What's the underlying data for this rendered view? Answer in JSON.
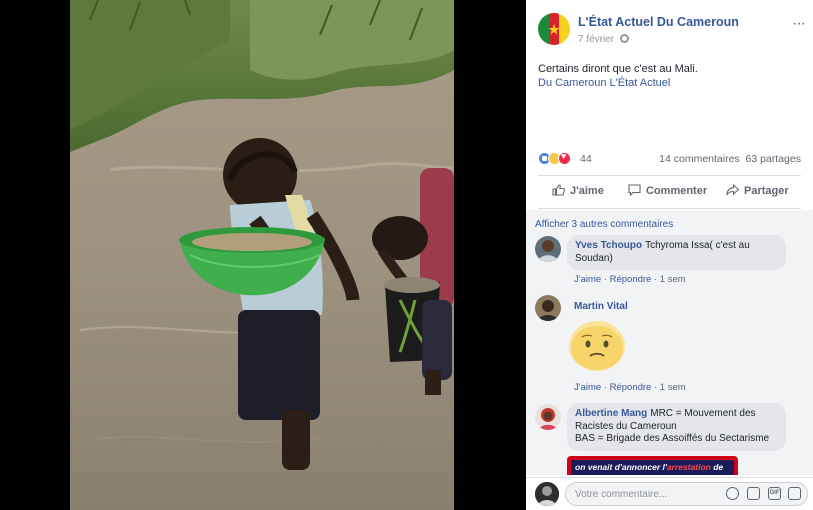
{
  "post": {
    "page_name": "L'État Actuel Du Cameroun",
    "date": "7 février",
    "text": "Certains diront que c'est au Mali.",
    "tags": "Du Cameroun L'État Actuel",
    "reactions_count": "44",
    "comments_count": "14 commentaires",
    "shares_count": "63 partages"
  },
  "actions": {
    "like": "J'aime",
    "comment": "Commenter",
    "share": "Partager"
  },
  "comments": {
    "view_more": "Afficher 3 autres commentaires",
    "items": [
      {
        "author": "Yves Tchoupo",
        "text": "Tchyroma Issa( c'est au Soudan)",
        "like": "J'aime",
        "reply": "Répondre",
        "time": "1 sem"
      },
      {
        "author": "Martin Vital",
        "text": "",
        "like": "J'aime",
        "reply": "Répondre",
        "time": "1 sem"
      },
      {
        "author": "Albertine Mang",
        "text": "MRC = Mouvement des Racistes du Cameroun",
        "text2": "BAS = Brigade des Assoiffés du Sectarisme",
        "preview_text_a": "on venait d'annoncer l'",
        "preview_text_hl": "arrestation",
        "preview_text_b": " de"
      }
    ]
  },
  "composer": {
    "placeholder": "Votre commentaire..."
  },
  "colors": {
    "link": "#365899",
    "reaction_like": "#4a7fe6",
    "reaction_love": "#f0284a",
    "reaction_sad": "#f7c94a"
  },
  "icons": {
    "more": "more-icon",
    "globe": "globe-icon",
    "like": "thumbs-up-icon",
    "comment": "speech-bubble-icon",
    "share": "share-arrow-icon",
    "emoji": "smiley-icon",
    "camera": "camera-icon",
    "gif": "gif-icon",
    "sticker": "sticker-icon"
  }
}
